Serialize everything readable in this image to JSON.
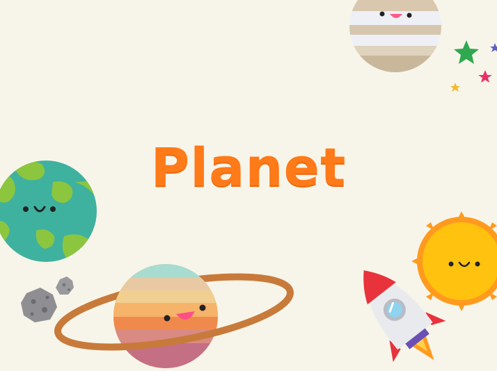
{
  "title": "Planet",
  "colors": {
    "background": "#f7f5e9",
    "title": "#ff7a18",
    "earth_ocean": "#3fb19f",
    "earth_land": "#8cc63f",
    "sun": "#ffc20e",
    "sun_rays": "#ff9a1f",
    "saturn_ring": "#c87a3a",
    "rocket_body": "#e9eaee",
    "rocket_red": "#e8323c",
    "star_green": "#2fa84f",
    "star_pink": "#e8316b",
    "star_yellow": "#f5b82e"
  },
  "icons": [
    "striped-planet-icon",
    "stars-icon",
    "earth-icon",
    "asteroids-icon",
    "saturn-icon",
    "sun-icon",
    "rocket-icon"
  ]
}
